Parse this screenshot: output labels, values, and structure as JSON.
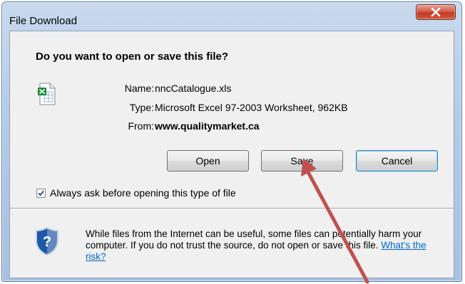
{
  "dialog": {
    "title": "File Download",
    "question": "Do you want to open or save this file?",
    "file_icon": "excel-file-icon",
    "info": {
      "name_label": "Name:",
      "name_value": "nncCatalogue.xls",
      "type_label": "Type:",
      "type_value": "Microsoft Excel 97-2003 Worksheet, 962KB",
      "from_label": "From:",
      "from_value": "www.qualitymarket.ca"
    },
    "buttons": {
      "open": "Open",
      "save": "Save",
      "cancel": "Cancel"
    },
    "always_ask": {
      "label": "Always ask before opening this type of file",
      "checked": true
    },
    "warning": {
      "icon": "shield-question-icon",
      "text": "While files from the Internet can be useful, some files can potentially harm your computer. If you do not trust the source, do not open or save this file.",
      "link": "What's the risk?"
    },
    "close_icon": "close-icon"
  },
  "annotation": {
    "arrow_color": "#c0504d",
    "points_to": "save-button"
  },
  "colors": {
    "link": "#0066cc",
    "close_button": "#c94a34",
    "title_bar": "#b9cfe8",
    "client_bg": "#f0f0f0"
  }
}
